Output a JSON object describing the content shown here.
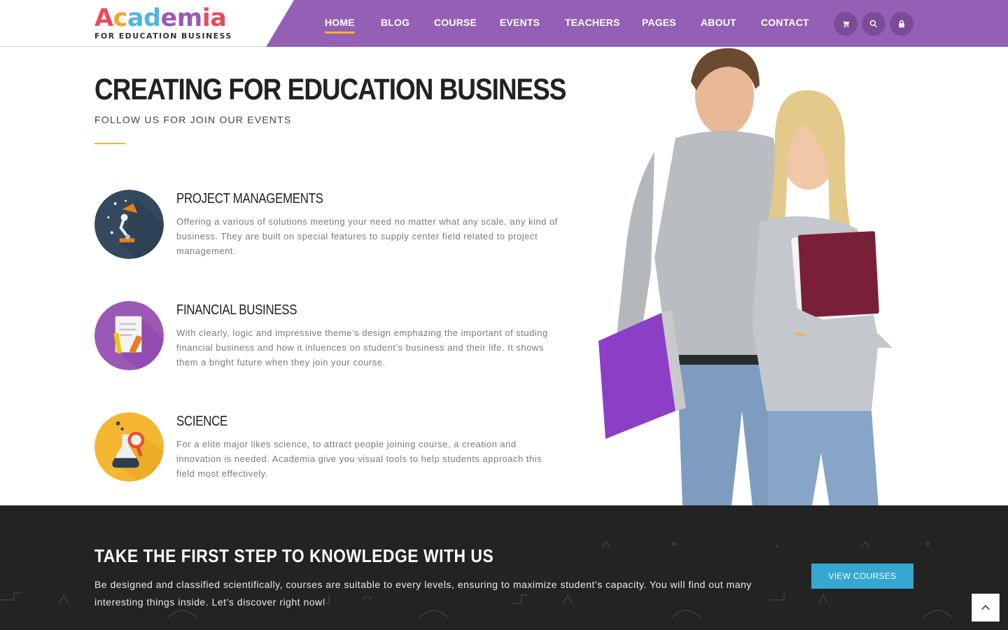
{
  "brand": {
    "logo_letters": [
      {
        "ch": "A",
        "color": "#e74c5e"
      },
      {
        "ch": "c",
        "color": "#f3a42b"
      },
      {
        "ch": "a",
        "color": "#4eb6de"
      },
      {
        "ch": "d",
        "color": "#4eb6de"
      },
      {
        "ch": "e",
        "color": "#9b59b6"
      },
      {
        "ch": "m",
        "color": "#9b59b6"
      },
      {
        "ch": "i",
        "color": "#e74c5e"
      },
      {
        "ch": "a",
        "color": "#e74c5e"
      }
    ],
    "tagline": "FOR EDUCATION BUSINESS"
  },
  "nav": {
    "items": [
      "HOME",
      "BLOG",
      "COURSE",
      "EVENTS",
      "TEACHERS",
      "PAGES",
      "ABOUT",
      "CONTACT"
    ],
    "active": "HOME",
    "buttons": [
      "cart-icon",
      "search-icon",
      "lock-icon"
    ]
  },
  "hero": {
    "title": "CREATING FOR EDUCATION BUSINESS",
    "subtitle": "FOLLOW US FOR JOIN OUR EVENTS"
  },
  "features": [
    {
      "title": "PROJECT MANAGEMENTS",
      "text": "Offering a various of solutions meeting your need no matter what any scale, any kind of business. They are built on special features to supply center field related to project management.",
      "icon": "desk-lamp-icon",
      "color": "#34495e"
    },
    {
      "title": "FINANCIAL BUSINESS",
      "text": "With clearly, logic and impressive theme’s design emphazing the important of studing financial business and how it inluences on student’s business and their life. It shows them a bright future when they join your course.",
      "icon": "document-pencil-icon",
      "color": "#9b59b6"
    },
    {
      "title": "SCIENCE",
      "text": "For a elite major likes science, to attract people joining course, a creation and innovation is needed. Academia give you visual tools to help students approach this field most effectively.",
      "icon": "flask-magnifier-icon",
      "color": "#f5b731"
    }
  ],
  "cta": {
    "title": "TAKE THE FIRST STEP TO KNOWLEDGE WITH US",
    "text": "Be designed and classified scientifically, courses are suitable to every levels, ensuring to maximize student’s capacity. You will find out many interesting things inside. Let’s discover right now!",
    "button": "VIEW COURSES"
  },
  "colors": {
    "accent": "#9460b5",
    "underline": "#f6b42e",
    "button": "#35a7d1",
    "band": "#232323"
  }
}
